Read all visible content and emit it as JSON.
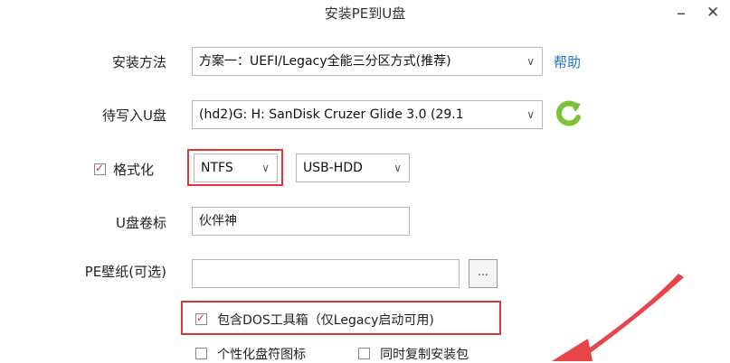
{
  "window": {
    "title": "安装PE到U盘",
    "minimize": "–",
    "close": "✕"
  },
  "install_method": {
    "label": "安装方法",
    "value": "方案一：UEFI/Legacy全能三分区方式(推荐)",
    "help": "帮助"
  },
  "target_disk": {
    "label": "待写入U盘",
    "value": "(hd2)G: H: SanDisk Cruzer Glide 3.0 (29.1",
    "refresh_icon": "refresh-icon"
  },
  "format": {
    "label": "格式化",
    "checked": true,
    "fs_value": "NTFS",
    "mode_value": "USB-HDD"
  },
  "volume_label": {
    "label": "U盘卷标",
    "value": "伙伴神"
  },
  "wallpaper": {
    "label": "PE壁纸(可选)",
    "value": "",
    "browse": "..."
  },
  "options": {
    "include_dos": "包含DOS工具箱（仅Legacy启动可用)",
    "personalize_icon": "个性化盘符图标",
    "copy_installer": "同时复制安装包"
  },
  "colors": {
    "accent_red": "#e0333a",
    "link_blue": "#1a73c8",
    "refresh_green": "#7cc238"
  },
  "chevron": "∨"
}
